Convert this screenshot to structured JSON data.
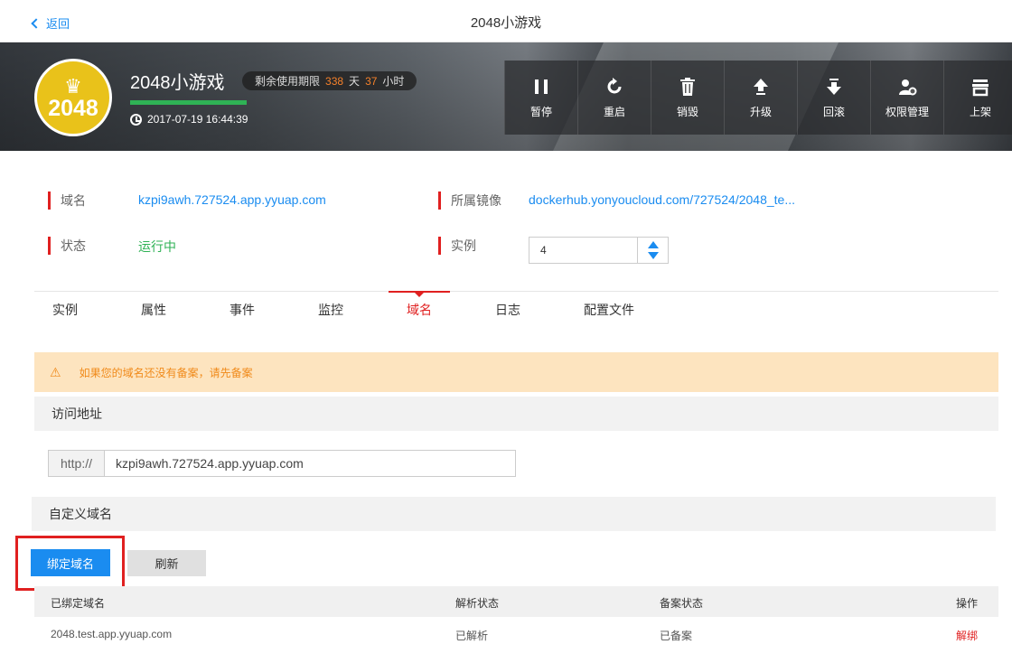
{
  "header": {
    "back_label": "返回",
    "title": "2048小游戏"
  },
  "app": {
    "logo_text": "2048",
    "name": "2048小游戏",
    "quota_label": "剩余使用期限",
    "quota_days": "338",
    "days_unit": "天",
    "quota_hours": "37",
    "hours_unit": "小时",
    "created_time": "2017-07-19 16:44:39",
    "progress": 1.0
  },
  "actions": [
    {
      "label": "暂停",
      "icon": "pause-icon"
    },
    {
      "label": "重启",
      "icon": "restart-icon"
    },
    {
      "label": "销毁",
      "icon": "trash-icon"
    },
    {
      "label": "升级",
      "icon": "upgrade-icon"
    },
    {
      "label": "回滚",
      "icon": "rollback-icon"
    },
    {
      "label": "权限管理",
      "icon": "permission-icon"
    },
    {
      "label": "上架",
      "icon": "store-icon"
    }
  ],
  "info": {
    "domain_label": "域名",
    "domain_value": "kzpi9awh.727524.app.yyuap.com",
    "status_label": "状态",
    "status_value": "运行中",
    "image_label": "所属镜像",
    "image_value": "dockerhub.yonyoucloud.com/727524/2048_te...",
    "instance_label": "实例",
    "instance_value": "4"
  },
  "tabs": [
    "实例",
    "属性",
    "事件",
    "监控",
    "域名",
    "日志",
    "配置文件"
  ],
  "active_tab": "域名",
  "alert": {
    "text": "如果您的域名还没有备案，请先备案"
  },
  "access": {
    "title": "访问地址",
    "prefix": "http://",
    "url": "kzpi9awh.727524.app.yyuap.com"
  },
  "custom": {
    "title": "自定义域名",
    "bind_button": "绑定域名",
    "refresh_button": "刷新"
  },
  "table": {
    "headers": [
      "已绑定域名",
      "解析状态",
      "备案状态",
      "操作"
    ],
    "rows": [
      {
        "domain": "2048.test.app.yyuap.com",
        "resolve": "已解析",
        "record": "已备案",
        "action": "解绑"
      }
    ]
  },
  "colors": {
    "accent": "#1a8cf0",
    "danger": "#e02020",
    "success": "#2fb255",
    "warning_bg": "#fde4bf",
    "warning_text": "#f08a1a"
  }
}
